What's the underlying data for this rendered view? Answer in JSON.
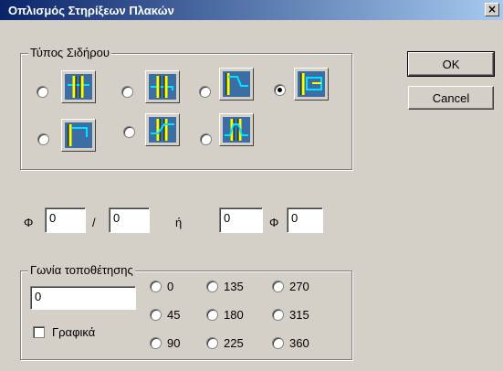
{
  "window": {
    "title": "Οπλισμός Στηρίξεων Πλακών",
    "close_glyph": "×"
  },
  "buttons": {
    "ok": "OK",
    "cancel": "Cancel"
  },
  "bar_type": {
    "legend": "Τύπος Σιδήρου",
    "selected_index": 3,
    "options": [
      {
        "icon": "bar-type-straight-tee-icon"
      },
      {
        "icon": "bar-type-straight-hook-icon"
      },
      {
        "icon": "bar-type-bent-down-icon"
      },
      {
        "icon": "bar-type-closed-loop-icon"
      },
      {
        "icon": "bar-type-l-shape-icon"
      },
      {
        "icon": "bar-type-cranked-icon"
      },
      {
        "icon": "bar-type-double-crank-icon"
      }
    ]
  },
  "diameter_spacing": {
    "phi_label_1": "Φ",
    "diameter_1": "0",
    "slash": "/",
    "spacing": "0",
    "or_label": "ή",
    "count": "0",
    "phi_label_2": "Φ",
    "diameter_2": "0"
  },
  "angle": {
    "legend": "Γωνία τοποθέτησης",
    "value": "0",
    "graphic_label": "Γραφικά",
    "graphic_checked": false,
    "options": [
      "0",
      "135",
      "270",
      "45",
      "180",
      "315",
      "90",
      "225",
      "360"
    ]
  },
  "colors": {
    "icon_background": "#3a6ea5",
    "icon_line_yellow": "#ffff00",
    "icon_line_cyan": "#00e5ff",
    "icon_line_black": "#000000"
  }
}
